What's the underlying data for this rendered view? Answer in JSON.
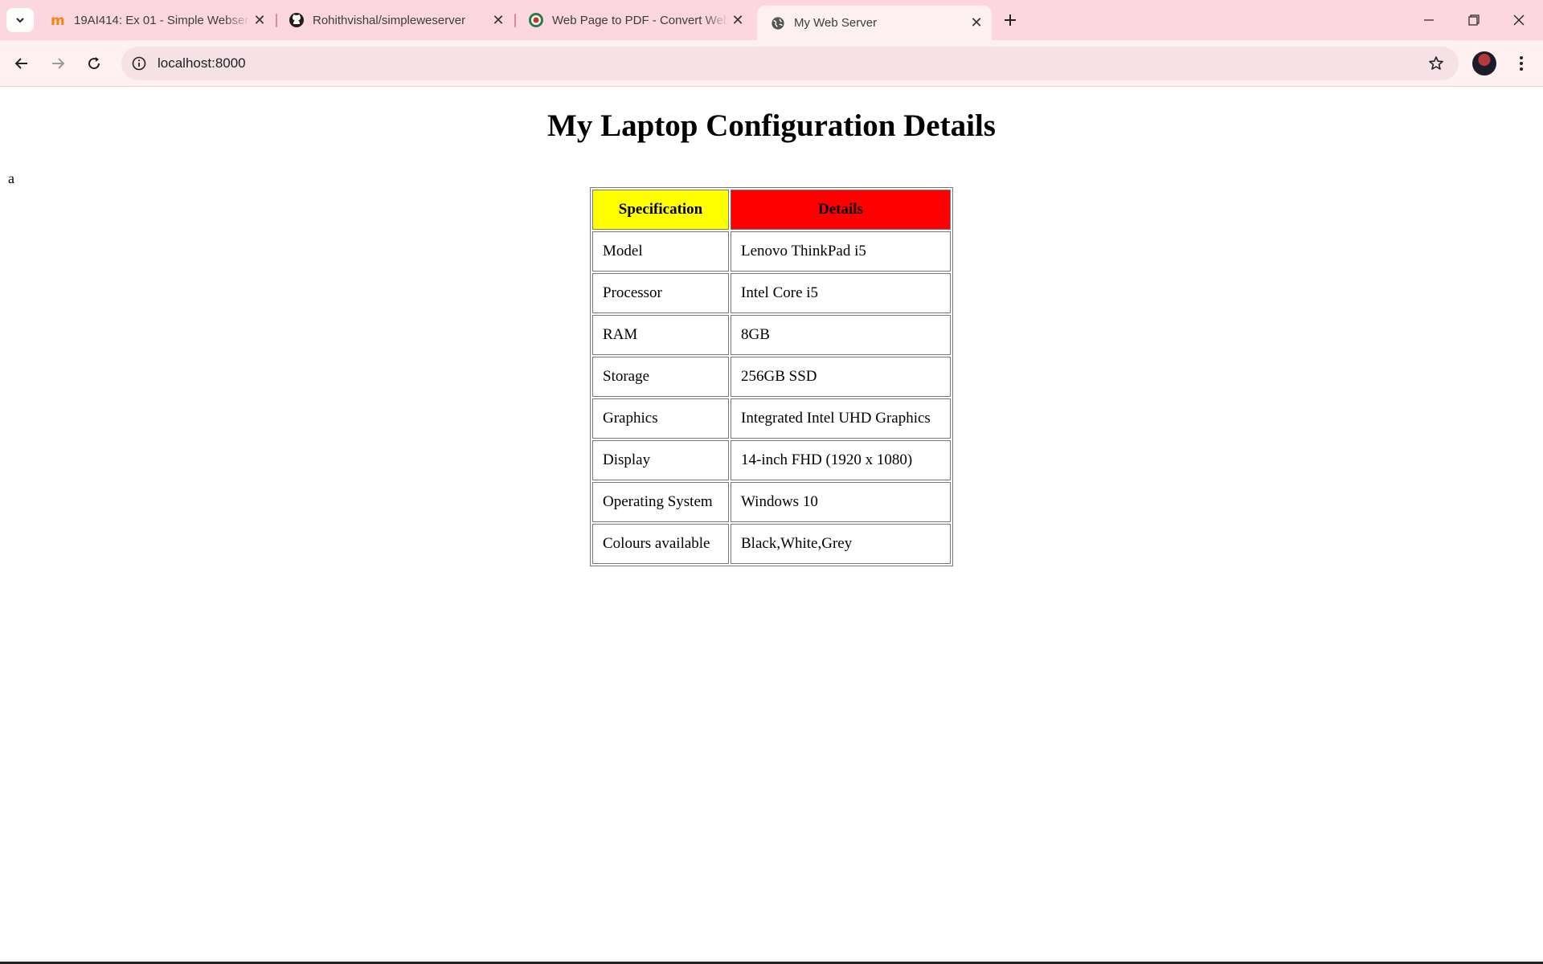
{
  "browser": {
    "tabs": [
      {
        "title": "19AI414: Ex 01 - Simple Webser",
        "favicon": "moodle-icon",
        "active": false
      },
      {
        "title": "Rohithvishal/simpleweserver",
        "favicon": "github-icon",
        "active": false
      },
      {
        "title": "Web Page to PDF - Convert Web",
        "favicon": "pdf-converter-icon",
        "active": false
      },
      {
        "title": "My Web Server",
        "favicon": "globe-icon",
        "active": true
      }
    ],
    "url": "localhost:8000"
  },
  "page": {
    "heading": "My Laptop Configuration Details",
    "stray_text": "a",
    "table": {
      "headers": [
        "Specification",
        "Details"
      ],
      "header_colors": [
        "#ffff00",
        "#ff0000"
      ],
      "rows": [
        [
          "Model",
          "Lenovo ThinkPad i5"
        ],
        [
          "Processor",
          "Intel Core i5"
        ],
        [
          "RAM",
          "8GB"
        ],
        [
          "Storage",
          "256GB SSD"
        ],
        [
          "Graphics",
          "Integrated Intel UHD Graphics"
        ],
        [
          "Display",
          "14-inch FHD (1920 x 1080)"
        ],
        [
          "Operating System",
          "Windows 10"
        ],
        [
          "Colours available",
          "Black,White,Grey"
        ]
      ]
    }
  }
}
